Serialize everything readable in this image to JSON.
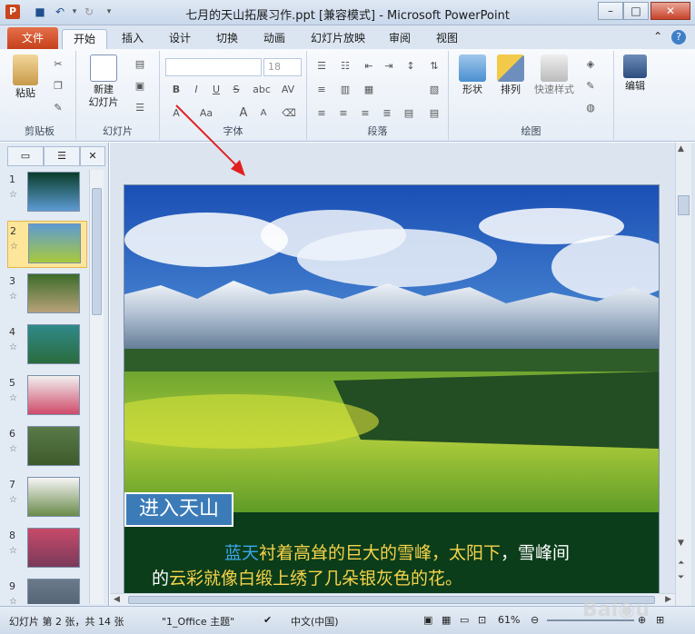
{
  "window": {
    "title": "七月的天山拓展习作.ppt [兼容模式] - Microsoft PowerPoint",
    "app_icon": "P"
  },
  "tabs": [
    {
      "label": "文件"
    },
    {
      "label": "开始"
    },
    {
      "label": "插入"
    },
    {
      "label": "设计"
    },
    {
      "label": "切换"
    },
    {
      "label": "动画"
    },
    {
      "label": "幻灯片放映"
    },
    {
      "label": "审阅"
    },
    {
      "label": "视图"
    }
  ],
  "ribbon": {
    "clipboard": {
      "paste": "粘贴",
      "group": "剪贴板"
    },
    "slides": {
      "new_slide_1": "新建",
      "new_slide_2": "幻灯片",
      "group": "幻灯片"
    },
    "font": {
      "size": "18",
      "group": "字体",
      "bold": "B",
      "italic": "I",
      "underline": "U",
      "strike": "S",
      "shadow": "abc",
      "spacing": "AV",
      "aa": "Aa",
      "grow": "A",
      "shrink": "A"
    },
    "paragraph": {
      "group": "段落"
    },
    "drawing": {
      "shapes": "形状",
      "arrange": "排列",
      "quick_styles": "快速样式",
      "group": "绘图"
    },
    "editing": {
      "label": "编辑"
    }
  },
  "thumbnails": [
    "1",
    "2",
    "3",
    "4",
    "5",
    "6",
    "7",
    "8",
    "9"
  ],
  "selected_slide": "2",
  "slide": {
    "title": "进入天山",
    "line1_a": "蓝天",
    "line1_b": "衬着高耸的巨大的雪峰，",
    "line1_c": "太阳下",
    "line1_d": "，雪峰间",
    "line2_a": "的",
    "line2_b": "云彩就像白缎上绣了几朵银灰色的花。"
  },
  "status": {
    "slide_info": "幻灯片 第 2 张，共 14 张",
    "theme": "\"1_Office 主题\"",
    "language": "中文(中国)",
    "zoom": "61%"
  },
  "colors": {
    "file_tab": "#c5401b",
    "caption_bg": "#0b3d1a",
    "title_box": "#3b7bb8"
  }
}
